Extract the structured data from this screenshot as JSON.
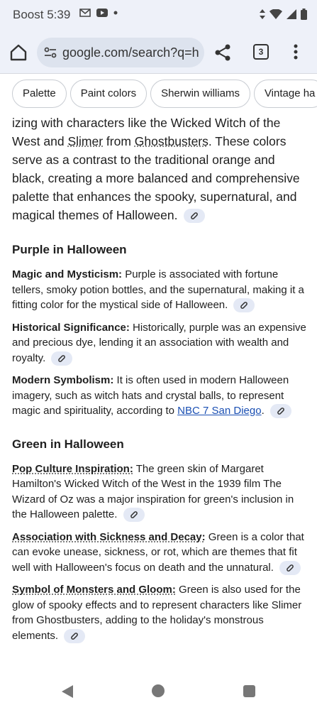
{
  "status_bar": {
    "carrier_time": "Boost 5:39",
    "icons": [
      "gmail-icon",
      "youtube-icon",
      "dot-icon",
      "data-arrows-icon",
      "wifi-icon",
      "signal-icon",
      "battery-icon"
    ]
  },
  "toolbar": {
    "url": "google.com/search?q=h",
    "tab_count": "3"
  },
  "chips": [
    "Palette",
    "Paint colors",
    "Sherwin williams",
    "Vintage ha"
  ],
  "intro": {
    "part1": "izing with characters like the Wicked Witch of the West and ",
    "slimer": "Slimer",
    "part2": " from ",
    "ghostbusters": "Ghostbusters",
    "part3": ". These colors serve as a contrast to the traditional orange and black, creating a more balanced and comprehensive palette that enhances the spooky, supernatural, and magical themes of Halloween."
  },
  "purple": {
    "title": "Purple in Halloween",
    "items": [
      {
        "label": "Magic and Mysticism:",
        "text": " Purple is associated with fortune tellers, smoky potion bottles, and the supernatural, making it a fitting color for the mystical side of Halloween."
      },
      {
        "label": "Historical Significance:",
        "text": " Historically, purple was an expensive and precious dye, lending it an association with wealth and royalty."
      },
      {
        "label": "Modern Symbolism:",
        "text": " It is often used in modern Halloween imagery, such as witch hats and crystal balls, to represent magic and spirituality, according to ",
        "link": "NBC 7 San Diego",
        "after": "."
      }
    ]
  },
  "green": {
    "title": "Green in Halloween",
    "items": [
      {
        "label": "Pop Culture Inspiration:",
        "text": " The green skin of Margaret Hamilton's Wicked Witch of the West in the 1939 film The Wizard of Oz was a major inspiration for green's inclusion in the Halloween palette."
      },
      {
        "label": "Association with Sickness and Decay:",
        "text": " Green is a color that can evoke unease, sickness, or rot, which are themes that fit well with Halloween's focus on death and the unnatural."
      },
      {
        "label": "Symbol of Monsters and Gloom:",
        "text": " Green is also used for the glow of spooky effects and to represent characters like Slimer from Ghostbusters, adding to the holiday's monstrous elements."
      }
    ]
  },
  "colors": {
    "accent_link": "#1a4fb3",
    "chrome_bg": "#eef1f9",
    "link_chip_bg": "#e4e9f5"
  }
}
